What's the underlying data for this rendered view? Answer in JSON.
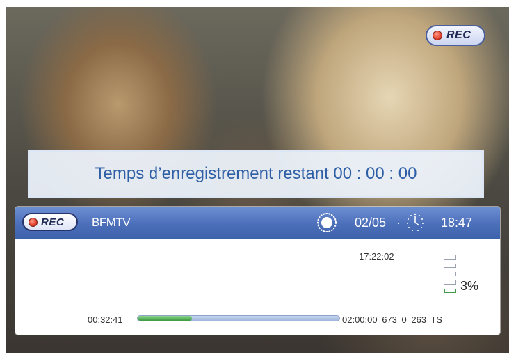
{
  "top_badge": {
    "label": "REC"
  },
  "message": {
    "text": "Temps d’enregistrement restant 00 : 00 : 00"
  },
  "infobar": {
    "rec_label": "REC",
    "channel": "BFMTV",
    "date": "02/05",
    "separator": "·",
    "time": "18:47",
    "timestamp": "17:22:02",
    "signal_percent_text": "3%",
    "signal_level": 0.03,
    "elapsed": "00:32:41",
    "total": "02:00:00 673 0 263 TS",
    "progress": 0.27
  },
  "icons": [
    "rec-dot-icon",
    "sun-icon",
    "clock-icon",
    "signal-bars-icon"
  ],
  "colors": {
    "header": "#4c6fba",
    "message_text": "#2e5fa6",
    "progress_fill": "#3c9b3f",
    "rec_red": "#e2412d"
  }
}
